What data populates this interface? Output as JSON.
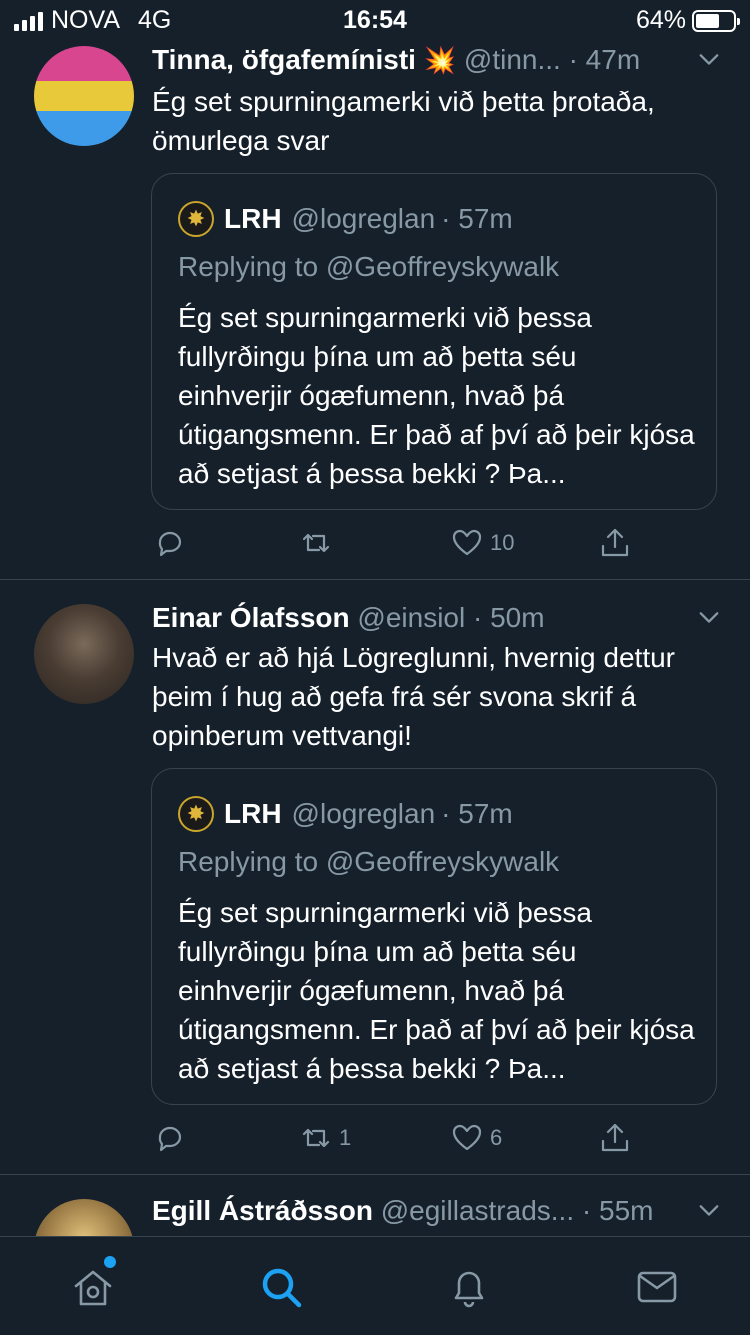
{
  "status_bar": {
    "carrier": "NOVA",
    "network": "4G",
    "time": "16:54",
    "battery": "64%",
    "battery_level": 0.64
  },
  "tweets": [
    {
      "name": "Tinna, öfgafemínisti",
      "emoji": "💥",
      "handle": "@tinn...",
      "time": "· 47m",
      "text": "Ég set spurningamerki við þetta þrotaða, ömurlega svar",
      "quote": {
        "name": "LRH",
        "handle": "@logreglan",
        "time": "· 57m",
        "replying": "Replying to @Geoffreyskywalk",
        "text": "Ég set spurningarmerki við þessa fullyrðingu þína um að þetta séu einhverjir ógæfumenn, hvað þá útigangsmenn.  Er það af því að þeir kjósa að setjast á þessa bekki ?  Þa..."
      },
      "retweets": "",
      "likes": "10"
    },
    {
      "name": "Einar Ólafsson",
      "handle": "@einsiol",
      "time": "· 50m",
      "text": "Hvað er að hjá Lögreglunni, hvernig dettur þeim í hug að gefa frá sér svona skrif á opinberum vettvangi!",
      "quote": {
        "name": "LRH",
        "handle": "@logreglan",
        "time": "· 57m",
        "replying": "Replying to @Geoffreyskywalk",
        "text": "Ég set spurningarmerki við þessa fullyrðingu þína um að þetta séu einhverjir ógæfumenn, hvað þá útigangsmenn.  Er það af því að þeir kjósa að setjast á þessa bekki ?  Þa..."
      },
      "retweets": "1",
      "likes": "6"
    },
    {
      "name": "Egill Ástráðsson",
      "handle": "@egillastrads...",
      "time": "· 55m"
    }
  ],
  "tabs": [
    "home-icon",
    "search-icon",
    "bell-icon",
    "mail-icon"
  ],
  "colors": {
    "background": "#15202b",
    "muted": "#8899a6",
    "accent": "#1da1f2",
    "border": "#38444d"
  }
}
